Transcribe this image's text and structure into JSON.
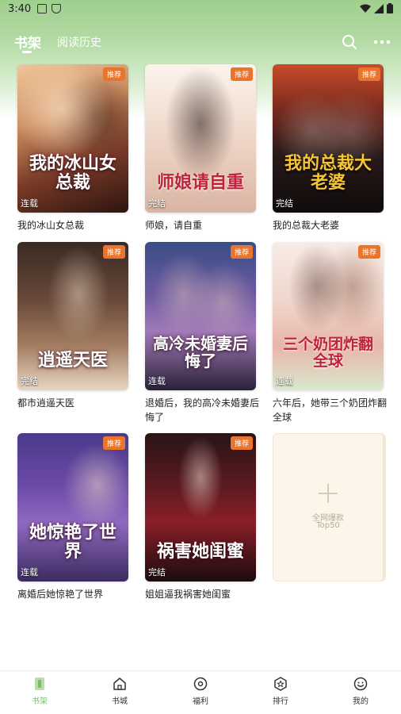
{
  "status_bar": {
    "time": "3:40"
  },
  "header": {
    "tabs": [
      {
        "label": "书架",
        "active": true
      },
      {
        "label": "阅读历史",
        "active": false
      }
    ]
  },
  "books": [
    {
      "title": "我的冰山女总裁",
      "cover_text": "我的冰山女总裁",
      "badge": "推荐",
      "status": "连载"
    },
    {
      "title": "师娘，请自重",
      "cover_text": "师娘请自重",
      "badge": "推荐",
      "status": "完结"
    },
    {
      "title": "我的总裁大老婆",
      "cover_text": "我的总裁大老婆",
      "badge": "推荐",
      "status": "完结"
    },
    {
      "title": "都市逍遥天医",
      "cover_text": "逍遥天医",
      "badge": "推荐",
      "status": "完结"
    },
    {
      "title": "退婚后，我的高冷未婚妻后悔了",
      "cover_text": "高冷未婚妻后悔了",
      "badge": "推荐",
      "status": "连载"
    },
    {
      "title": "六年后，她带三个奶团炸翻全球",
      "cover_text": "三个奶团炸翻全球",
      "badge": "推荐",
      "status": "连载"
    },
    {
      "title": "离婚后她惊艳了世界",
      "cover_text": "她惊艳了世界",
      "badge": "推荐",
      "status": "连载"
    },
    {
      "title": "姐姐逼我祸害她闺蜜",
      "cover_text": "祸害她闺蜜",
      "badge": "推荐",
      "status": "完结"
    }
  ],
  "add_card": {
    "line1": "全网爆款",
    "line2": "Top50"
  },
  "bottom_nav": [
    {
      "label": "书架",
      "icon": "bookshelf-icon",
      "active": true
    },
    {
      "label": "书城",
      "icon": "bookstore-icon",
      "active": false
    },
    {
      "label": "福利",
      "icon": "welfare-icon",
      "active": false
    },
    {
      "label": "排行",
      "icon": "ranking-icon",
      "active": false
    },
    {
      "label": "我的",
      "icon": "profile-icon",
      "active": false
    }
  ],
  "colors": {
    "accent": "#7dbb6a",
    "badge": "#e9742b",
    "header_gradient_top": "#9fcf8d"
  }
}
